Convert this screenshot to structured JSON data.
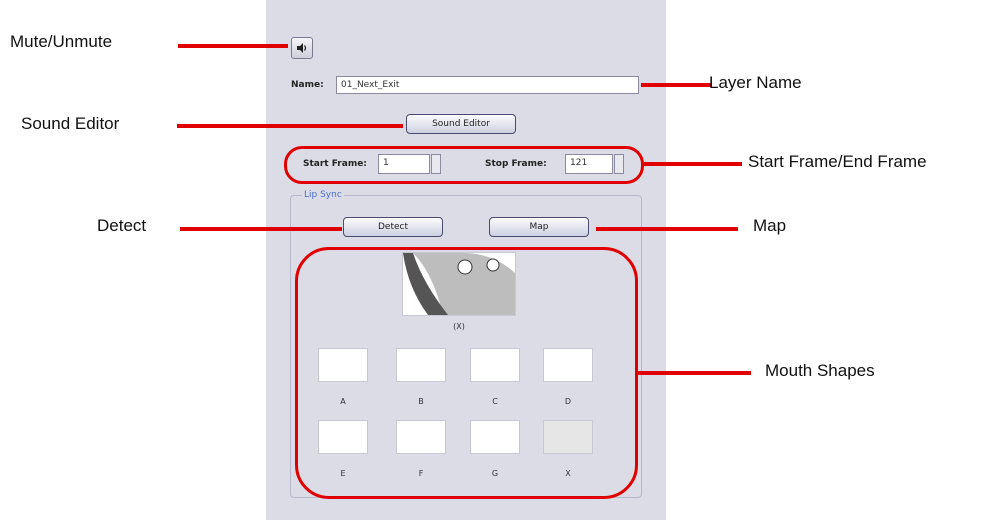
{
  "panel": {
    "mute_icon": "speaker-icon",
    "name_label": "Name:",
    "name_value": "01_Next_Exit",
    "sound_editor_label": "Sound Editor",
    "start_frame_label": "Start Frame:",
    "start_frame_value": "1",
    "stop_frame_label": "Stop Frame:",
    "stop_frame_value": "121",
    "lip_sync_label": "Lip Sync",
    "detect_label": "Detect",
    "map_label": "Map",
    "current_shape_label": "(X)",
    "mouth_shapes": [
      "A",
      "B",
      "C",
      "D",
      "E",
      "F",
      "G",
      "X"
    ]
  },
  "callouts": {
    "mute": "Mute/Unmute",
    "layer_name": "Layer Name",
    "sound_editor": "Sound Editor",
    "start_end": "Start Frame/End Frame",
    "detect": "Detect",
    "map": "Map",
    "mouth_shapes": "Mouth Shapes"
  },
  "colors": {
    "callout_red": "#e00000",
    "panel_bg": "#dcdce6",
    "group_label_blue": "#4a6ed0"
  }
}
